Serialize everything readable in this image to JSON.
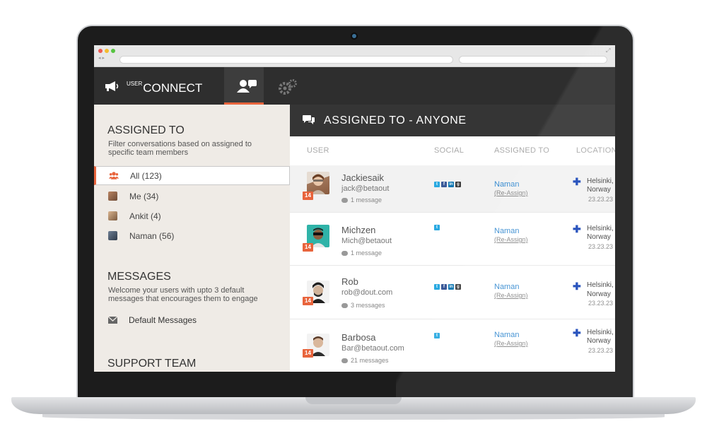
{
  "app": {
    "brand_sup": "USER",
    "brand_main": "CONNECT"
  },
  "sidebar": {
    "assigned": {
      "title": "ASSIGNED TO",
      "desc": "Filter conversations based on assigned to specific team members"
    },
    "filters": [
      {
        "label": "All (123)",
        "active": true,
        "icon": "users-group-icon"
      },
      {
        "label": "Me (34)",
        "active": false,
        "icon": "avatar"
      },
      {
        "label": "Ankit (4)",
        "active": false,
        "icon": "avatar"
      },
      {
        "label": "Naman (56)",
        "active": false,
        "icon": "avatar"
      }
    ],
    "messages": {
      "title": "MESSAGES",
      "desc": "Welcome your users with upto 3 default messages that encourages them to engage",
      "default_label": "Default Messages"
    },
    "support": {
      "title": "SUPPORT TEAM"
    }
  },
  "main": {
    "title": "ASSIGNED TO - ANYONE",
    "columns": {
      "user": "USER",
      "social": "SOCIAL",
      "assigned": "ASSIGNED TO",
      "location": "LOCATION"
    },
    "rows": [
      {
        "name": "Jackiesaik",
        "email": "jack@betaout",
        "messages": "1 message",
        "badge": "14",
        "assignee": "Naman",
        "reassign": "(Re-Assign)",
        "city": "Helsinki,",
        "country": "Norway",
        "time": "23.23.23"
      },
      {
        "name": "Michzen",
        "email": "Mich@betaout",
        "messages": "1 message",
        "badge": "14",
        "assignee": "Naman",
        "reassign": "(Re-Assign)",
        "city": "Helsinki,",
        "country": "Norway",
        "time": "23.23.23"
      },
      {
        "name": "Rob",
        "email": "rob@dout.com",
        "messages": "3 messages",
        "badge": "14",
        "assignee": "Naman",
        "reassign": "(Re-Assign)",
        "city": "Helsinki,",
        "country": "Norway",
        "time": "23.23.23"
      },
      {
        "name": "Barbosa",
        "email": "Bar@betaout.com",
        "messages": "21 messages",
        "badge": "14",
        "assignee": "Naman",
        "reassign": "(Re-Assign)",
        "city": "Helsinki,",
        "country": "Norway",
        "time": "23.23.23"
      }
    ]
  },
  "colors": {
    "accent": "#e8643c",
    "header": "#2e2e2e",
    "sidebar_bg": "#efebe6",
    "link": "#3a8dd1"
  }
}
